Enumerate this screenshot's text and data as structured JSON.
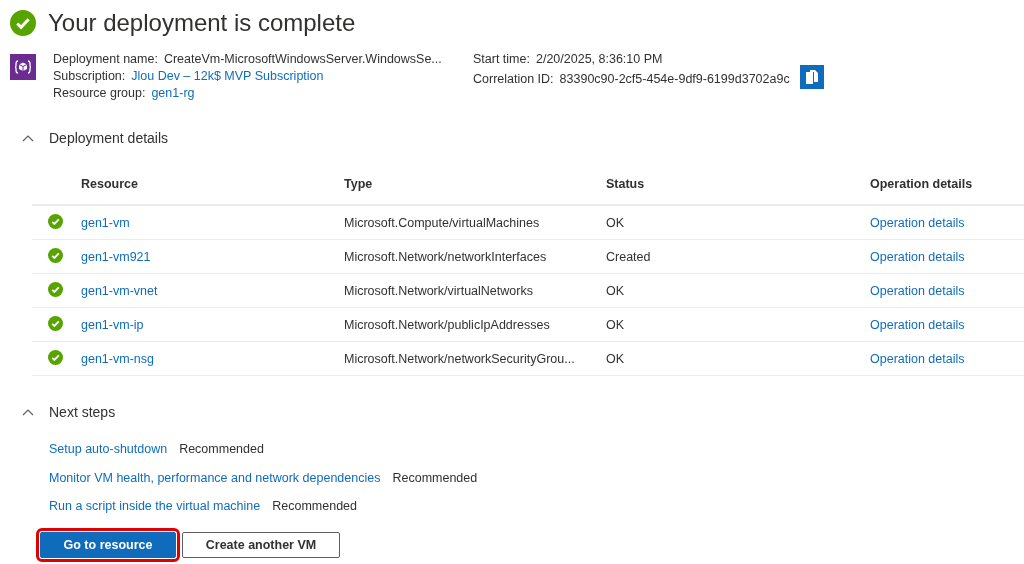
{
  "title": "Your deployment is complete",
  "info": {
    "left": [
      {
        "label": "Deployment name:",
        "value": "CreateVm-MicrosoftWindowsServer.WindowsSe...",
        "link": false
      },
      {
        "label": "Subscription:",
        "value": "Jlou Dev – 12k$ MVP Subscription",
        "link": true
      },
      {
        "label": "Resource group:",
        "value": "gen1-rg",
        "link": true
      }
    ],
    "right": [
      {
        "label": "Start time:",
        "value": "2/20/2025, 8:36:10 PM",
        "copy": false
      },
      {
        "label": "Correlation ID:",
        "value": "83390c90-2cf5-454e-9df9-6199d3702a9c",
        "copy": true
      }
    ]
  },
  "deployment_details": {
    "title": "Deployment details",
    "expanded": true,
    "columns": [
      "Resource",
      "Type",
      "Status",
      "Operation details"
    ],
    "rows": [
      {
        "resource": "gen1-vm",
        "type": "Microsoft.Compute/virtualMachines",
        "status": "OK",
        "operation": "Operation details"
      },
      {
        "resource": "gen1-vm921",
        "type": "Microsoft.Network/networkInterfaces",
        "status": "Created",
        "operation": "Operation details"
      },
      {
        "resource": "gen1-vm-vnet",
        "type": "Microsoft.Network/virtualNetworks",
        "status": "OK",
        "operation": "Operation details"
      },
      {
        "resource": "gen1-vm-ip",
        "type": "Microsoft.Network/publicIpAddresses",
        "status": "OK",
        "operation": "Operation details"
      },
      {
        "resource": "gen1-vm-nsg",
        "type": "Microsoft.Network/networkSecurityGrou...",
        "status": "OK",
        "operation": "Operation details"
      }
    ]
  },
  "next_steps": {
    "title": "Next steps",
    "expanded": true,
    "items": [
      {
        "link": "Setup auto-shutdown",
        "tag": "Recommended"
      },
      {
        "link": "Monitor VM health, performance and network dependencies",
        "tag": "Recommended"
      },
      {
        "link": "Run a script inside the virtual machine",
        "tag": "Recommended"
      }
    ]
  },
  "buttons": [
    {
      "label": "Go to resource",
      "kind": "primary",
      "highlighted": true
    },
    {
      "label": "Create another VM",
      "kind": "secondary",
      "highlighted": false
    }
  ]
}
